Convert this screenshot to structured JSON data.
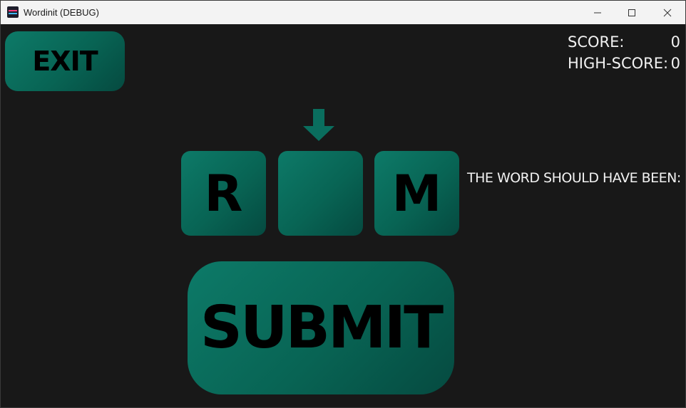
{
  "window": {
    "title": "Wordinit (DEBUG)"
  },
  "game": {
    "exit_label": "EXIT",
    "score_label": "SCORE:",
    "score_value": "0",
    "high_score_label": "HIGH-SCORE:",
    "high_score_value": "0",
    "tiles": [
      {
        "letter": "R"
      },
      {
        "letter": ""
      },
      {
        "letter": "M"
      }
    ],
    "reveal_text": "THE WORD SHOULD HAVE BEEN:",
    "submit_label": "SUBMIT"
  },
  "colors": {
    "background": "#181818",
    "accent": "#0a6e5e",
    "text": "#f2f2f2"
  },
  "icons": {
    "arrow": "arrow-down-icon",
    "minimize": "minimize-icon",
    "maximize": "maximize-icon",
    "close": "close-icon"
  }
}
